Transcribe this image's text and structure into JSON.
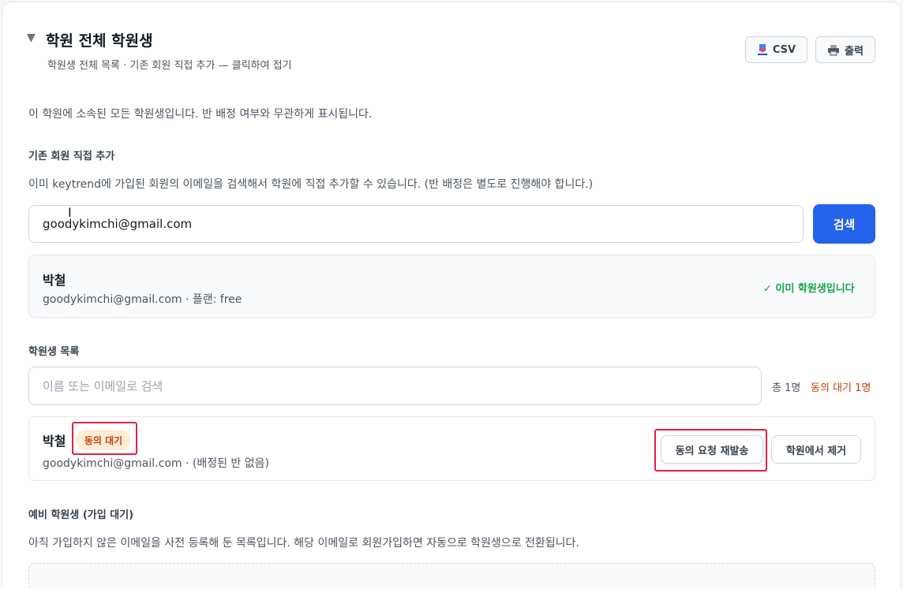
{
  "section": {
    "title": "학원 전체 학원생",
    "subtitle": "학원생 전체 목록 · 기존 회원 직접 추가 — 클릭하여 접기",
    "caret_glyph": "▼",
    "csv_label": "CSV",
    "print_label": "출력",
    "description": "이 학원에 소속된 모든 학원생입니다. 반 배정 여부와 무관하게 표시됩니다."
  },
  "add_member": {
    "label": "기존 회원 직접 추가",
    "help": "이미 keytrend에 가입된 회원의 이메일을 검색해서 학원에 직접 추가할 수 있습니다. (반 배정은 별도로 진행해야 합니다.)",
    "email_value": "goodykimchi@gmail.com",
    "search_button": "검색",
    "result": {
      "name": "박철",
      "meta": "goodykimchi@gmail.com · 플랜: free",
      "status": "✓ 이미 학원생입니다"
    }
  },
  "student_list": {
    "label": "학원생 목록",
    "search_placeholder": "이름 또는 이메일로 검색",
    "total": "총 1명",
    "pending": "동의 대기 1명",
    "rows": [
      {
        "name": "박철",
        "badge": "동의 대기",
        "meta": "goodykimchi@gmail.com · (배정된 반 없음)",
        "resend_label": "동의 요청 재발송",
        "remove_label": "학원에서 제거"
      }
    ]
  },
  "pre_students": {
    "label": "예비 학원생 (가입 대기)",
    "help": "아직 가입하지 않은 이메일을 사전 등록해 둔 목록입니다. 해당 이메일로 회원가입하면 자동으로 학원생으로 전환됩니다."
  },
  "colors": {
    "primary": "#2563eb",
    "success": "#16a34a",
    "warning": "#c2410c",
    "highlight": "#e11d48"
  }
}
